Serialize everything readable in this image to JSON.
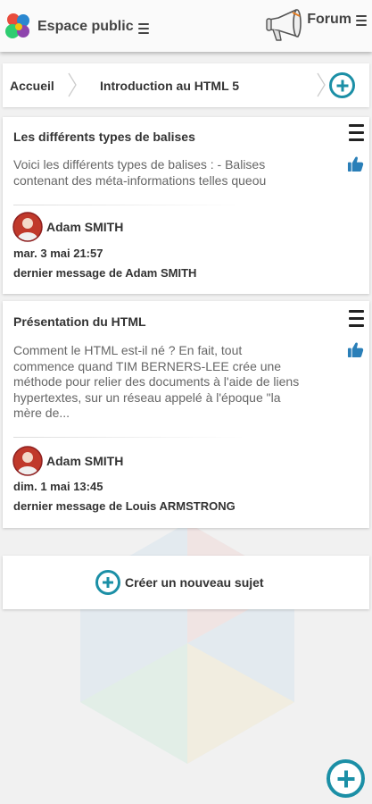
{
  "header": {
    "brand_label": "Espace public",
    "forum_label": "Forum"
  },
  "breadcrumb": {
    "home": "Accueil",
    "current": "Introduction au HTML 5"
  },
  "topics": [
    {
      "title": "Les différents types de balises",
      "excerpt": "Voici les différents types de balises : - Balises contenant des méta-informations telles queou",
      "author": "Adam SMITH",
      "date": "mar. 3 mai 21:57",
      "last_message": "dernier message de Adam SMITH"
    },
    {
      "title": "Présentation du HTML",
      "excerpt": "Comment le HTML est-il né ? En fait, tout commence quand TIM BERNERS-LEE crée une méthode pour relier des documents à l'aide de liens hypertextes, sur un réseau appelé à l'époque \"la mère de...",
      "author": "Adam SMITH",
      "date": "dim. 1 mai 13:45",
      "last_message": "dernier message de Louis ARMSTRONG"
    }
  ],
  "new_topic": {
    "label": "Créer un nouveau sujet"
  },
  "colors": {
    "accent": "#1b8fa6",
    "like": "#2a7fb8",
    "page_background": "#f1f1f1"
  },
  "icons": {
    "brand": "app-logo-icon",
    "forum": "megaphone-icon",
    "menu": "hamburger-menu-icon",
    "like": "thumbs-up-icon",
    "add": "plus-circle-icon",
    "separator": "chevron-right-icon"
  }
}
